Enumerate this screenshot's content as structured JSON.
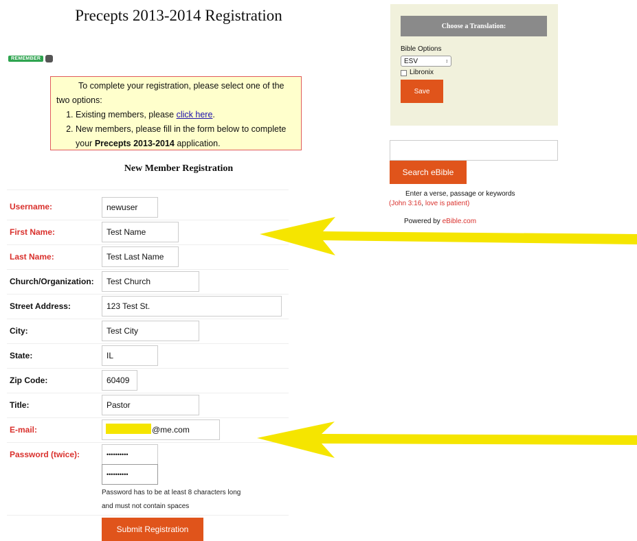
{
  "page": {
    "title": "Precepts 2013-2014 Registration",
    "remember_badge": "REMEMBER"
  },
  "notice": {
    "intro": "To complete your registration, please select one of the two options:",
    "item1_prefix": "Existing members, please",
    "item1_link": "click here",
    "item1_suffix": ".",
    "item2_prefix": "New members, please fill in the form below to complete your",
    "item2_bold": "Precepts 2013-2014",
    "item2_suffix": "application."
  },
  "form": {
    "section_title": "New Member Registration",
    "fields": {
      "username": {
        "label": "Username:",
        "value": "newuser"
      },
      "first_name": {
        "label": "First Name:",
        "value": "Test Name"
      },
      "last_name": {
        "label": "Last Name:",
        "value": "Test Last Name"
      },
      "church": {
        "label": "Church/Organization:",
        "value": "Test Church"
      },
      "street": {
        "label": "Street Address:",
        "value": "123 Test St."
      },
      "city": {
        "label": "City:",
        "value": "Test City"
      },
      "state": {
        "label": "State:",
        "value": "IL"
      },
      "zip": {
        "label": "Zip Code:",
        "value": "60409"
      },
      "title": {
        "label": "Title:",
        "value": "Pastor"
      },
      "email": {
        "label": "E-mail:",
        "value": "@me.com"
      },
      "password": {
        "label": "Password (twice):",
        "value": "••••••••••",
        "confirm_value": "••••••••••"
      }
    },
    "password_hint_1": "Password has to be at least 8 characters long",
    "password_hint_2": "and must not contain spaces",
    "submit_label": "Submit Registration"
  },
  "sidebar": {
    "translation_header": "Choose a Translation:",
    "bible_options_label": "Bible Options",
    "translation_selected": "ESV",
    "libronix_label": "Libronix",
    "save_label": "Save",
    "search_button": "Search eBible",
    "search_help": "Enter a verse, passage or keywords",
    "example_open": "(",
    "example_1": "John 3:16",
    "example_sep": ", ",
    "example_2": "love is patient",
    "example_close": ")",
    "powered_prefix": "Powered by ",
    "powered_link": "eBible.com"
  },
  "colors": {
    "required_label": "#d9302c",
    "button_orange": "#e0541b",
    "arrow_yellow": "#f5e500",
    "notice_bg": "#ffffcc"
  }
}
